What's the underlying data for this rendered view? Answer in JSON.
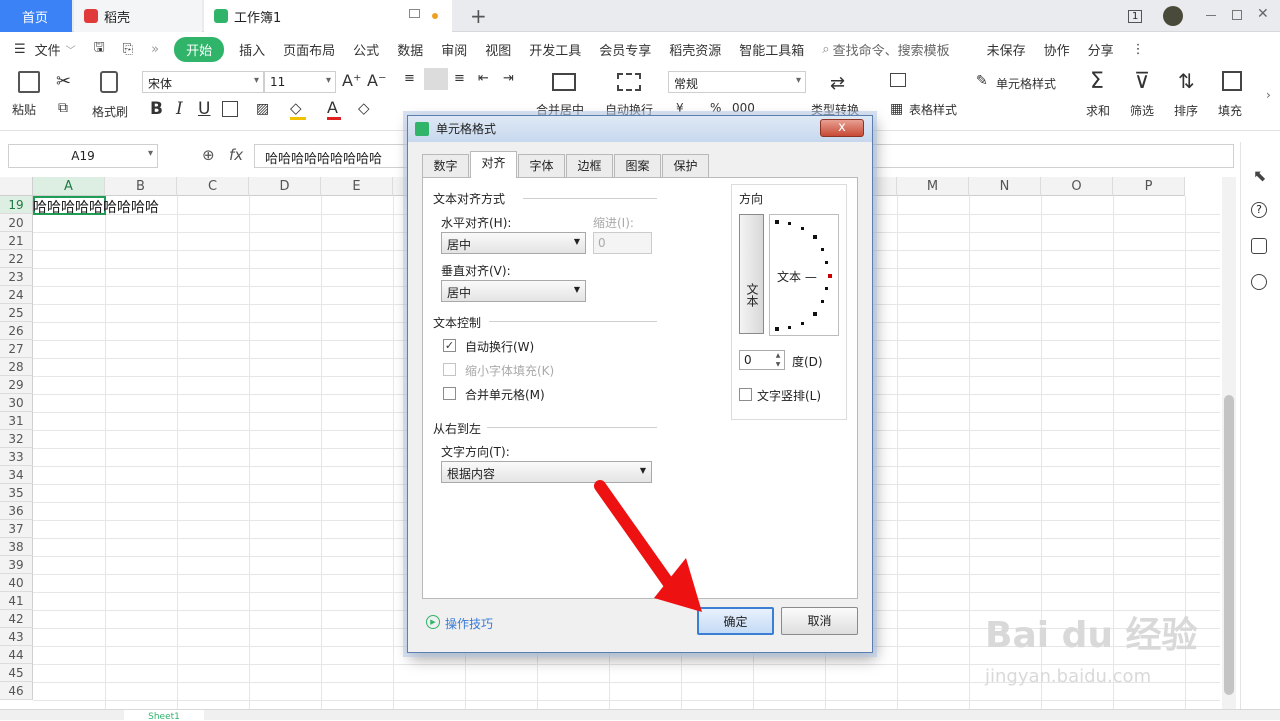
{
  "tabs": {
    "home": "首页",
    "daoke": "稻壳",
    "workbook": "工作簿1",
    "plus": "+",
    "badge": "1"
  },
  "menu": {
    "file": "文件",
    "start": "开始",
    "insert": "插入",
    "layout": "页面布局",
    "formula": "公式",
    "data": "数据",
    "review": "审阅",
    "view": "视图",
    "dev": "开发工具",
    "member": "会员专享",
    "daoke_res": "稻壳资源",
    "smart": "智能工具箱",
    "search": "查找命令、搜索模板",
    "unsaved": "未保存",
    "collab": "协作",
    "share": "分享"
  },
  "ribbon": {
    "paste": "粘贴",
    "format_painter": "格式刷",
    "font": "宋体",
    "size": "11",
    "merge": "合并居中",
    "wrap": "自动换行",
    "number_format": "常规",
    "convert": "类型转换",
    "cond_format": "单元格样式",
    "table_style": "表格样式",
    "sum": "求和",
    "filter": "筛选",
    "sort": "排序",
    "fill": "填充",
    "currency": "¥",
    "percent": "%",
    "thousands": "000"
  },
  "formula": {
    "cell_ref": "A19",
    "fx": "fx",
    "content": "哈哈哈哈哈哈哈哈哈"
  },
  "sheet": {
    "columns": [
      "A",
      "B",
      "C",
      "D",
      "E",
      "",
      "",
      "",
      "",
      "",
      "",
      "",
      "M",
      "N",
      "O",
      "P"
    ],
    "rows": [
      "19",
      "20",
      "21",
      "22",
      "23",
      "24",
      "25",
      "26",
      "27",
      "28",
      "29",
      "30",
      "31",
      "32",
      "33",
      "34",
      "35",
      "36",
      "37",
      "38",
      "39",
      "40",
      "41",
      "42",
      "43",
      "44",
      "45",
      "46"
    ],
    "a19": "哈哈哈哈哈哈哈哈哈",
    "sheet_tab": "Sheet1"
  },
  "dialog": {
    "title": "单元格格式",
    "close": "x",
    "tabs": [
      "数字",
      "对齐",
      "字体",
      "边框",
      "图案",
      "保护"
    ],
    "text_align_group": "文本对齐方式",
    "h_align_label": "水平对齐(H):",
    "h_align_value": "居中",
    "indent_label": "缩进(I):",
    "indent_value": "0",
    "v_align_label": "垂直对齐(V):",
    "v_align_value": "居中",
    "text_control_group": "文本控制",
    "wrap_text": "自动换行(W)",
    "shrink_fit": "缩小字体填充(K)",
    "merge_cells": "合并单元格(M)",
    "rtl_group": "从右到左",
    "text_dir_label": "文字方向(T):",
    "text_dir_value": "根据内容",
    "orientation_group": "方向",
    "vertical_text": "文本",
    "orient_text": "文本 —",
    "degree_value": "0",
    "degree_label": "度(D)",
    "vertical_arrange": "文字竖排(L)",
    "tips": "操作技巧",
    "ok": "确定",
    "cancel": "取消"
  },
  "watermark": {
    "brand": "Bai du 经验",
    "url": "jingyan.baidu.com"
  },
  "colors": {
    "accent_green": "#2fb46a",
    "arrow_red": "#ee1111",
    "tab_blue": "#3b82f6"
  }
}
